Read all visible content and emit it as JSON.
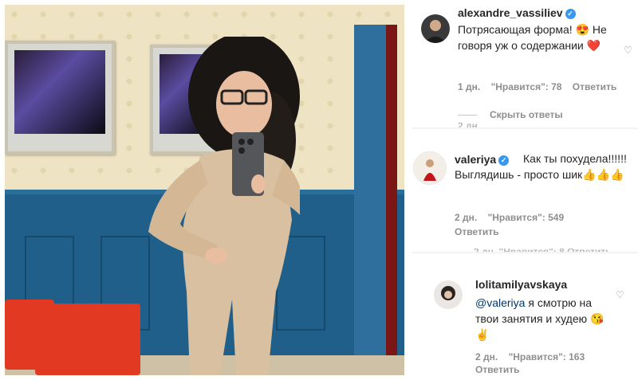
{
  "comments": [
    {
      "username": "alexandre_vassiliev",
      "text": "Потрясающая форма! 😍 Не говоря уж о содержании ❤️",
      "time": "1 дн.",
      "likes": "\"Нравится\": 78",
      "reply": "Ответить",
      "hide_replies": "Скрыть ответы",
      "ghost": "2 дн."
    },
    {
      "username": "valeriya",
      "text": "Как ты похудела!!!!!! Выглядишь - просто шик👍👍👍",
      "time": "2 дн.",
      "likes": "\"Нравится\": 549",
      "reply": "Ответить",
      "ghost": "2 дн.   \"Нравится\": 8   Ответить"
    },
    {
      "username": "lolitamilyavskaya",
      "mention": "@valeriya",
      "text": " я смотрю на твои занятия и худею 😘✌️",
      "time": "2 дн.",
      "likes": "\"Нравится\": 163",
      "reply": "Ответить"
    }
  ],
  "icons": {
    "verified": "verified-badge-icon",
    "like": "heart-outline-icon"
  },
  "colors": {
    "verified": "#3897f0",
    "username": "#262626",
    "meta": "#8e8e8e",
    "mention": "#00376b"
  }
}
